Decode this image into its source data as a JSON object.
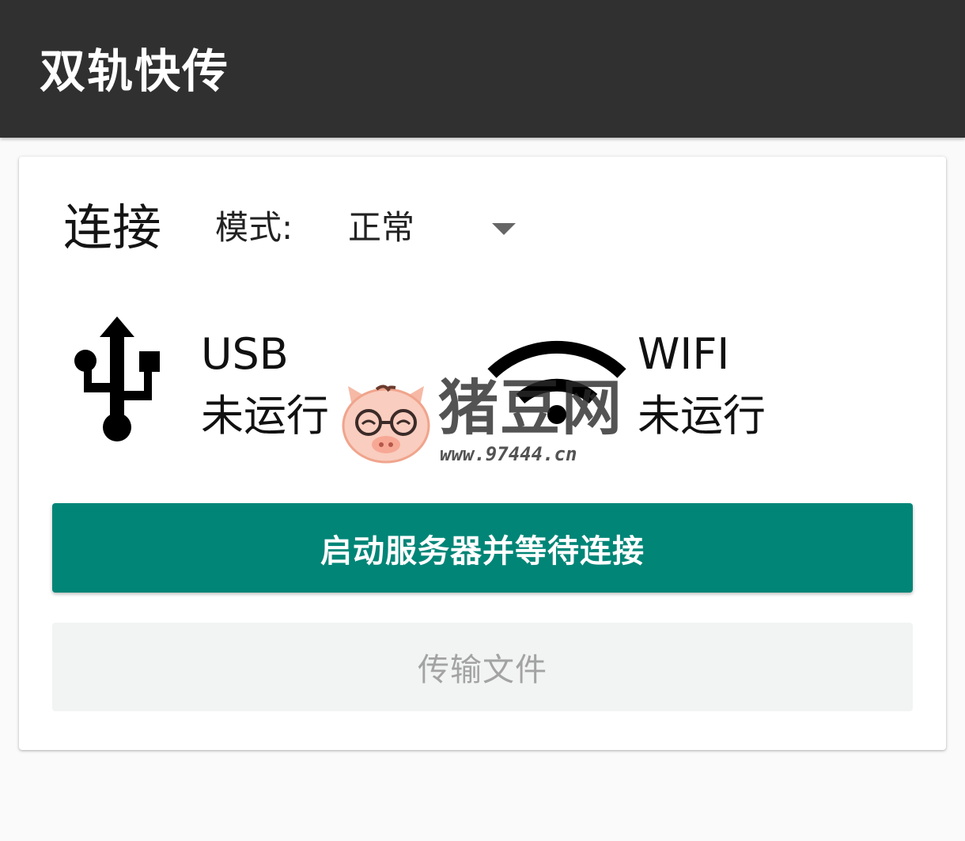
{
  "app": {
    "title": "双轨快传"
  },
  "connection": {
    "title": "连接",
    "mode_label": "模式:",
    "mode_value": "正常",
    "usb": {
      "icon": "usb-icon",
      "name": "USB",
      "status": "未运行"
    },
    "wifi": {
      "icon": "wifi-icon",
      "name": "WIFI",
      "status": "未运行"
    },
    "start_button_label": "启动服务器并等待连接",
    "transfer_button_label": "传输文件"
  },
  "watermark": {
    "brand": "猪豆网",
    "url": "www.97444.cn"
  },
  "colors": {
    "app_bar": "#303030",
    "accent": "#008577",
    "disabled_button": "#f2f3f3",
    "disabled_text": "#a3a3a3"
  }
}
